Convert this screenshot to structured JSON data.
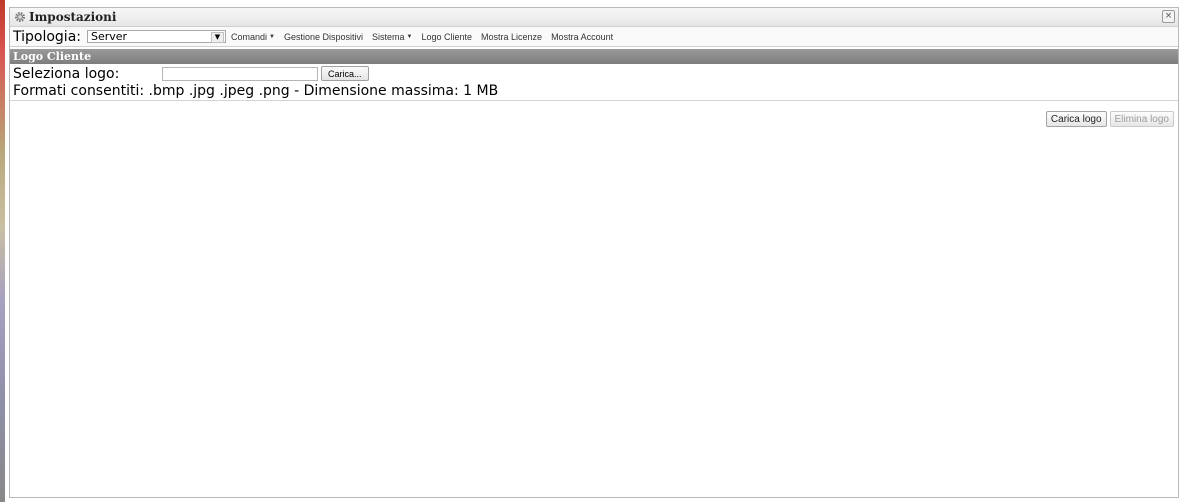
{
  "window": {
    "title": "Impostazioni",
    "title_icon": "gear-icon",
    "close_label": "×"
  },
  "toolbar": {
    "tipologia_label": "Tipologia:",
    "tipologia_value": "Server",
    "menu": [
      {
        "label": "Comandi",
        "has_dropdown": true
      },
      {
        "label": "Gestione Dispositivi",
        "has_dropdown": false
      },
      {
        "label": "Sistema",
        "has_dropdown": true
      },
      {
        "label": "Logo Cliente",
        "has_dropdown": false
      },
      {
        "label": "Mostra Licenze",
        "has_dropdown": false
      },
      {
        "label": "Mostra Account",
        "has_dropdown": false
      }
    ]
  },
  "panel": {
    "header": "Logo Cliente",
    "select_logo_label": "Seleziona logo:",
    "file_value": "",
    "browse_label": "Carica...",
    "formats_text": "Formati consentiti: .bmp .jpg .jpeg .png - Dimensione massima: 1 MB"
  },
  "actions": {
    "upload_label": "Carica logo",
    "delete_label": "Elimina logo",
    "delete_disabled": true
  },
  "colors": {
    "section_header_bg": "#8a8a8a",
    "border": "#b9b9b9"
  }
}
